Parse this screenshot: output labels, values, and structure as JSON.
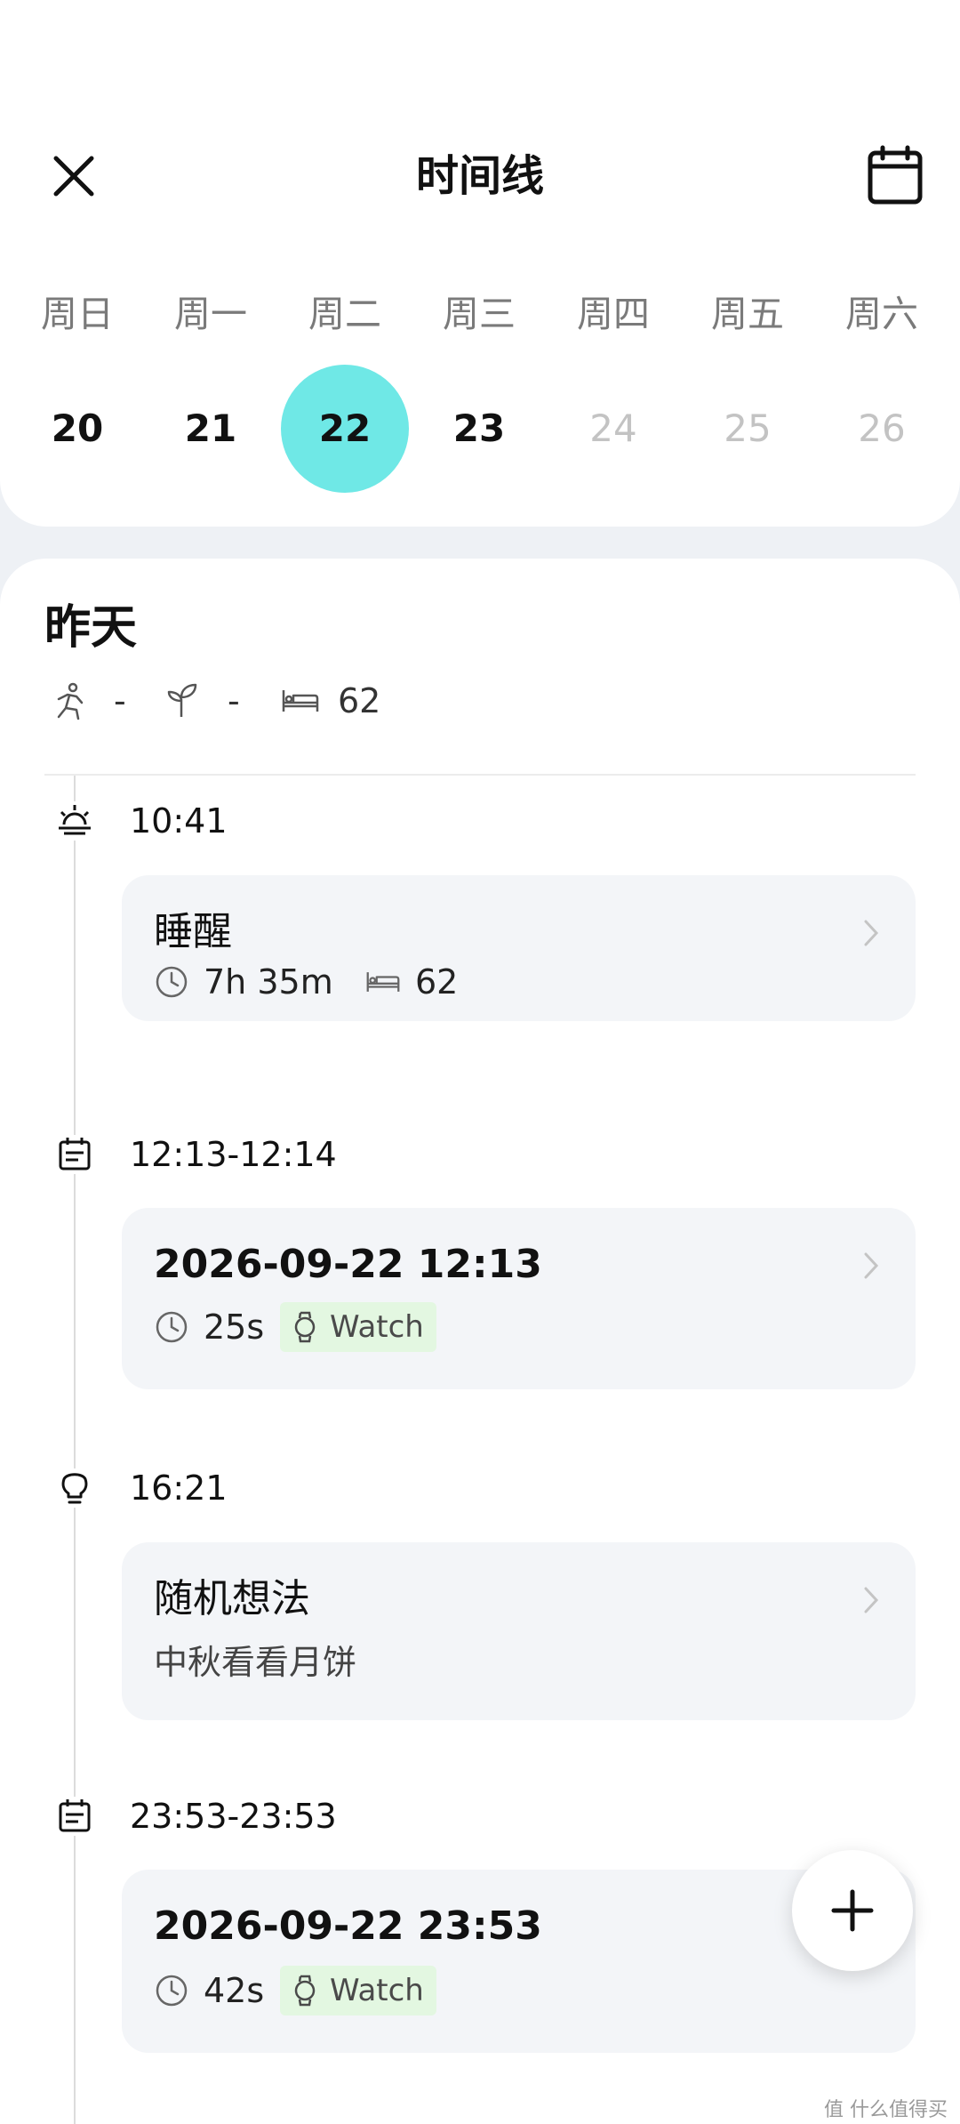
{
  "header": {
    "title": "时间线",
    "close_icon": "close-icon",
    "calendar_icon": "calendar-icon"
  },
  "week": {
    "weekdays": [
      "周日",
      "周一",
      "周二",
      "周三",
      "周四",
      "周五",
      "周六"
    ],
    "days": [
      "20",
      "21",
      "22",
      "23",
      "24",
      "25",
      "26"
    ],
    "selected_index": 2,
    "selected_color": "#6fe8e6"
  },
  "section": {
    "title": "昨天",
    "stats": {
      "activity_value": "-",
      "mindfulness_value": "-",
      "sleep_value": "62"
    }
  },
  "timeline": [
    {
      "icon": "sunrise-icon",
      "time": "10:41",
      "title": "睡醒",
      "duration": "7h 35m",
      "sleep_score": "62"
    },
    {
      "icon": "calendar-note-icon",
      "time": "12:13-12:14",
      "title": "2026-09-22 12:13",
      "duration": "25s",
      "device": "Watch"
    },
    {
      "icon": "lightbulb-icon",
      "time": "16:21",
      "title": "随机想法",
      "note": "中秋看看月饼"
    },
    {
      "icon": "calendar-note-icon",
      "time": "23:53-23:53",
      "title": "2026-09-22 23:53",
      "duration": "42s",
      "device": "Watch"
    }
  ],
  "fab": {
    "icon": "plus-icon"
  },
  "watermark": "值 什么值得买"
}
